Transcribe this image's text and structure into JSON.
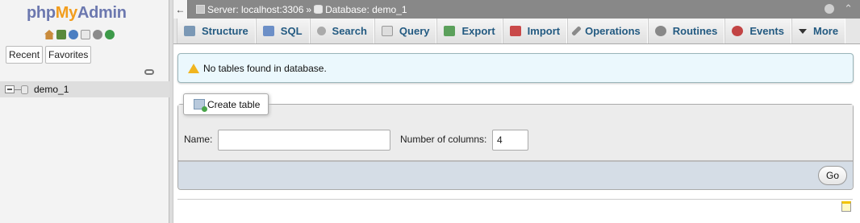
{
  "nav": {
    "logo": {
      "php": "php",
      "my": "My",
      "admin": "Admin"
    },
    "quick_icons": [
      "home-icon",
      "logout-icon",
      "help-icon",
      "docs-icon",
      "settings-icon",
      "reload-icon"
    ],
    "tabs": {
      "recent": "Recent",
      "favorites": "Favorites"
    },
    "tree": [
      {
        "label": "demo_1"
      }
    ]
  },
  "breadcrumb": {
    "server": "Server: localhost:3306",
    "separator": "»",
    "database": "Database: demo_1"
  },
  "menu": {
    "tabs": [
      {
        "label": "Structure",
        "icon": "structure-icon"
      },
      {
        "label": "SQL",
        "icon": "sql-icon"
      },
      {
        "label": "Search",
        "icon": "search-icon"
      },
      {
        "label": "Query",
        "icon": "query-icon"
      },
      {
        "label": "Export",
        "icon": "export-icon"
      },
      {
        "label": "Import",
        "icon": "import-icon"
      },
      {
        "label": "Operations",
        "icon": "operations-icon"
      },
      {
        "label": "Routines",
        "icon": "routines-icon"
      },
      {
        "label": "Events",
        "icon": "events-icon"
      },
      {
        "label": "More",
        "icon": "caret-down-icon"
      }
    ]
  },
  "notice": {
    "text": "No tables found in database."
  },
  "create_table": {
    "legend": "Create table",
    "name_label": "Name:",
    "name_value": "",
    "columns_label": "Number of columns:",
    "columns_value": "4",
    "go_label": "Go"
  },
  "colors": {
    "topbar": "#888888",
    "tab_text": "#235a81",
    "notice_bg": "#ebf8fd",
    "logo_blue": "#6c78af",
    "logo_orange": "#f29d1d"
  }
}
